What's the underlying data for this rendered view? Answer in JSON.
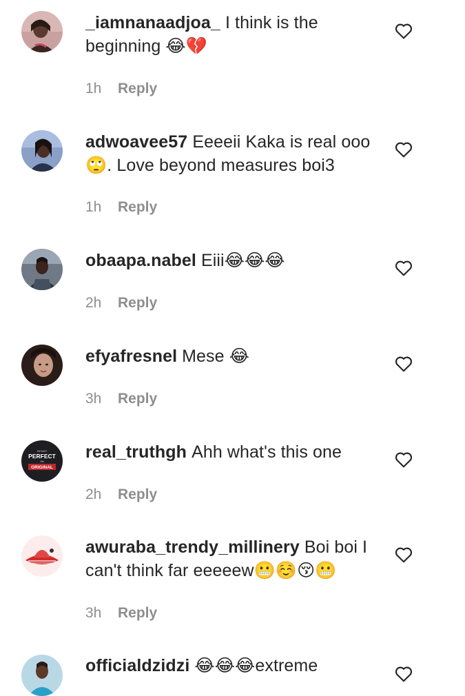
{
  "comments": [
    {
      "username": "_iamnanaadjoa_",
      "text": "I think is the beginning 😂💔",
      "time": "1h",
      "reply_label": "Reply",
      "avatar": "woman-portrait-avatar"
    },
    {
      "username": "adwoavee57",
      "text": "Eeeeii Kaka is real ooo 🙄. Love beyond measures boi3",
      "time": "1h",
      "reply_label": "Reply",
      "avatar": "woman-portrait-avatar"
    },
    {
      "username": "obaapa.nabel",
      "text": "Eiii😂😂😂",
      "time": "2h",
      "reply_label": "Reply",
      "avatar": "woman-portrait-avatar"
    },
    {
      "username": "efyafresnel",
      "text": "Mese 😂",
      "time": "3h",
      "reply_label": "Reply",
      "avatar": "woman-portrait-avatar"
    },
    {
      "username": "real_truthgh",
      "text": "Ahh what's this one",
      "time": "2h",
      "reply_label": "Reply",
      "avatar": "text-logo-avatar",
      "avatar_text": {
        "line1": "I'M NOT",
        "line2": "PERFECT",
        "line3": "I'M",
        "line4": "ORIGINAL"
      }
    },
    {
      "username": "awuraba_trendy_millinery",
      "text": "Boi boi I can't think far eeeeew😬☺️😚😬",
      "time": "3h",
      "reply_label": "Reply",
      "avatar": "hat-brand-avatar"
    },
    {
      "username": "officialdzidzi",
      "text": "😂😂😂extreme",
      "time": "",
      "reply_label": "",
      "avatar": "woman-portrait-avatar"
    }
  ],
  "icons": {
    "like": "heart-outline-icon"
  },
  "colors": {
    "text": "#262626",
    "secondary": "#8e8e8e",
    "background": "#ffffff"
  }
}
